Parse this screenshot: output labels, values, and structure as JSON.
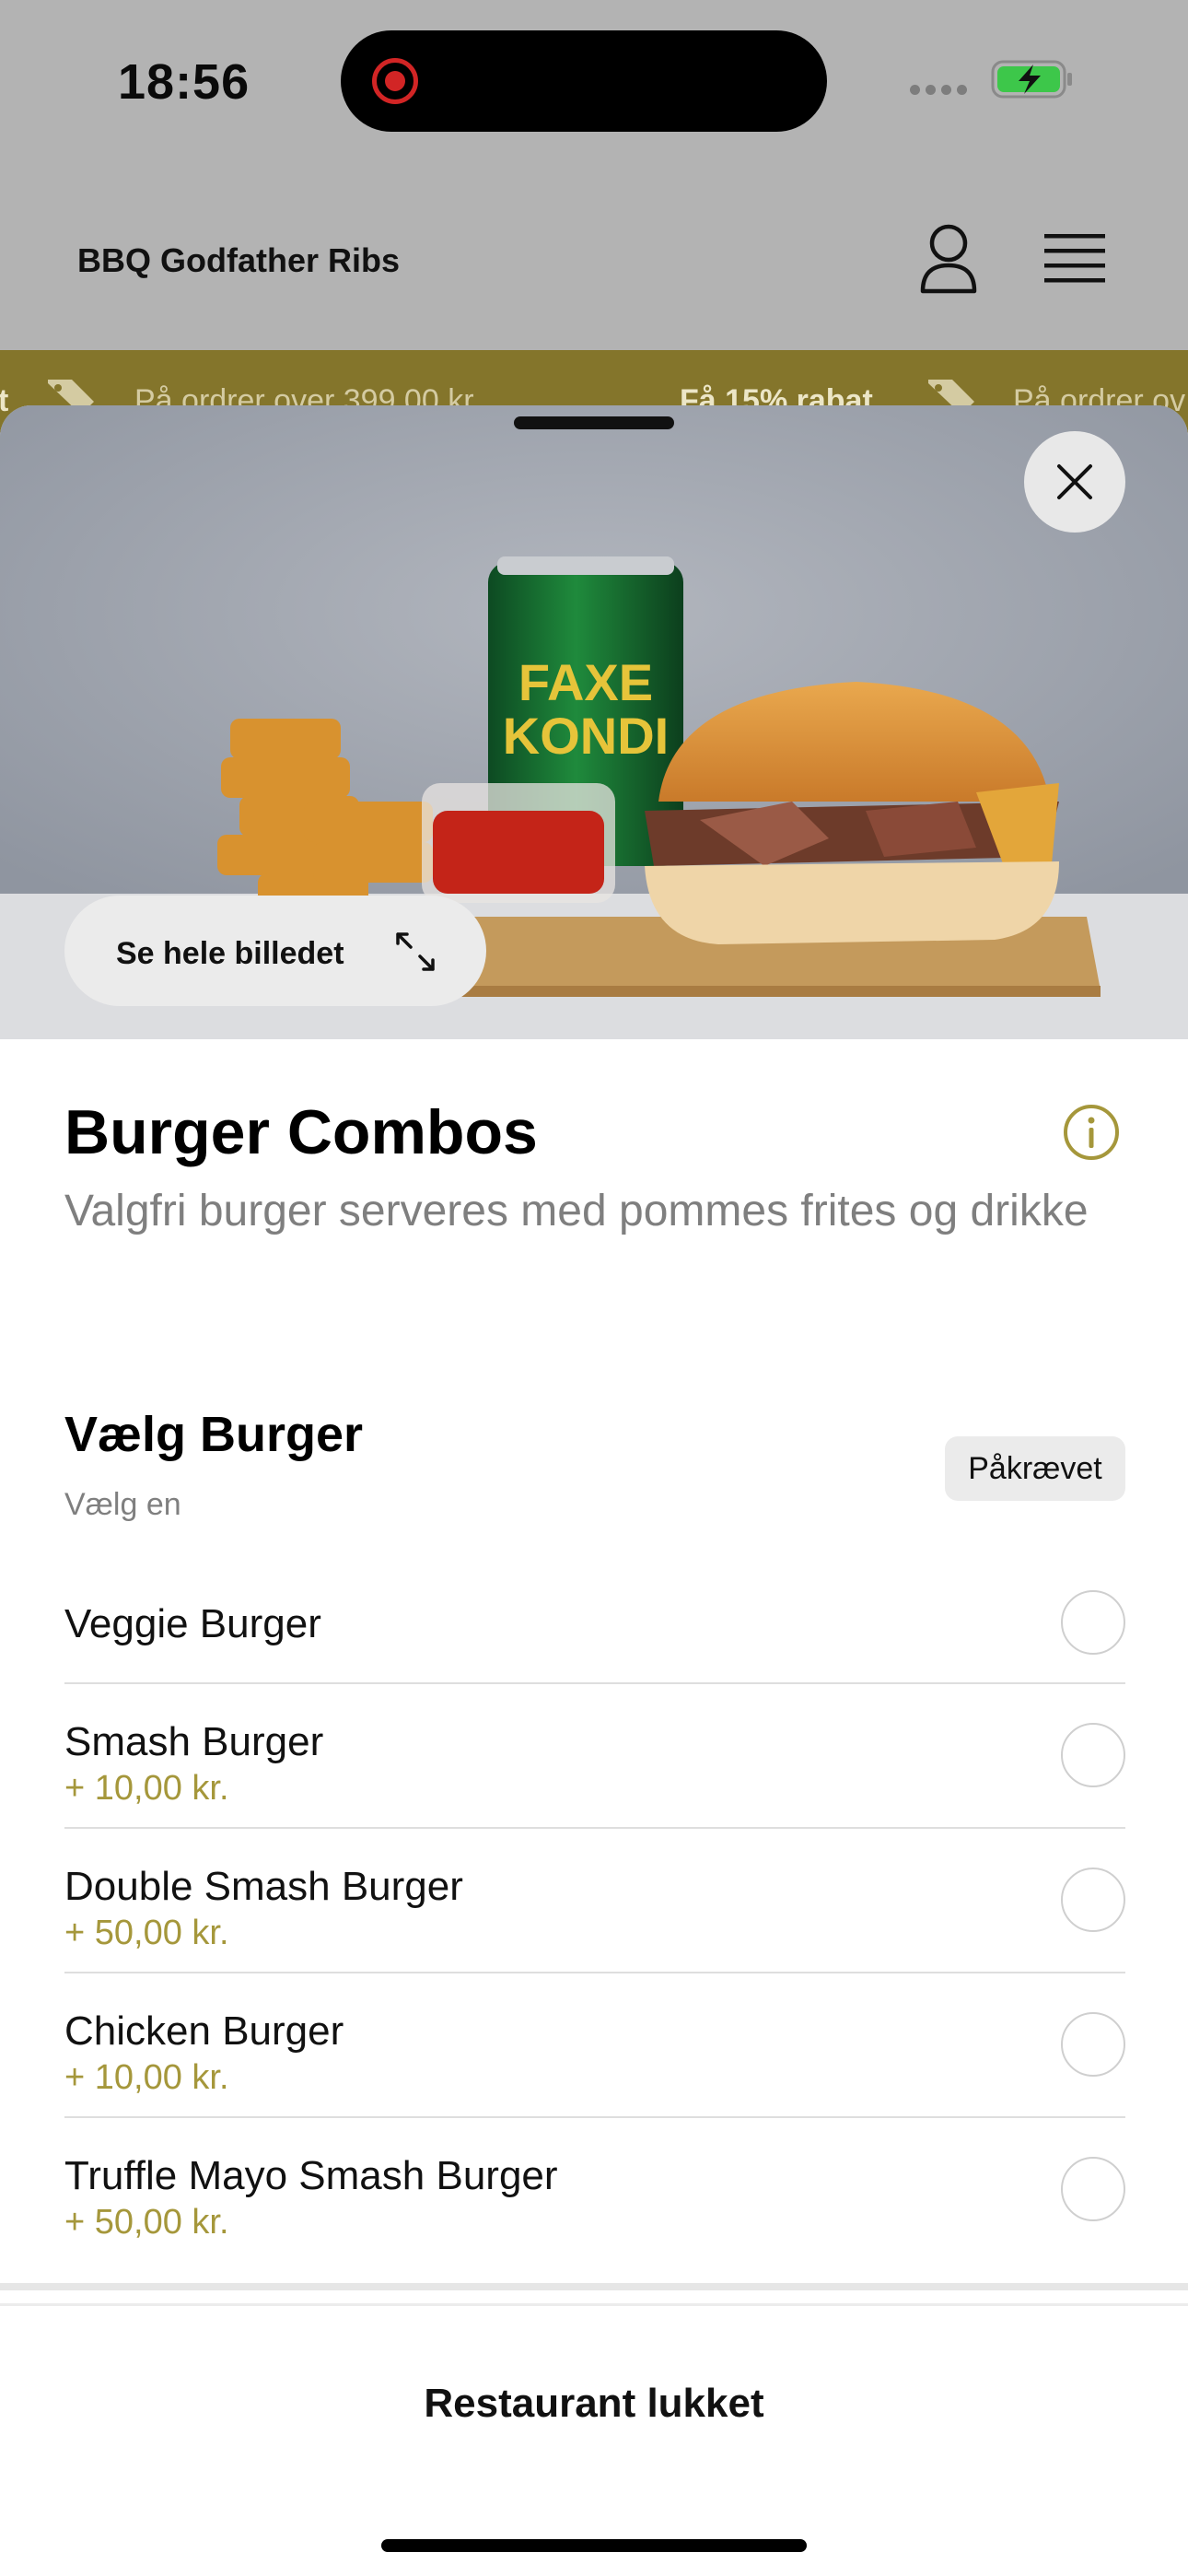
{
  "status_bar": {
    "time": "18:56"
  },
  "header": {
    "brand": "BBQ Godfather Ribs",
    "profile_icon": "person-icon",
    "menu_icon": "hamburger-menu-icon"
  },
  "promo_bar": {
    "items": [
      {
        "lead": "t",
        "text": ""
      },
      {
        "lead": "",
        "text": "På ordrer over 399,00 kr."
      },
      {
        "lead": "Få 15% rabat",
        "text": "På ordrer ov"
      }
    ],
    "color": "#84752b"
  },
  "hero": {
    "see_image_label": "Se hele billedet",
    "can_text_1": "FAXE",
    "can_text_2": "KONDI"
  },
  "product": {
    "title": "Burger Combos",
    "description": "Valgfri burger serveres med pommes frites og drikke"
  },
  "option_group": {
    "title": "Vælg Burger",
    "subtitle": "Vælg en",
    "badge": "Påkrævet",
    "options": [
      {
        "name": "Veggie Burger",
        "price": ""
      },
      {
        "name": "Smash Burger",
        "price": "+ 10,00 kr."
      },
      {
        "name": "Double Smash Burger",
        "price": "+ 50,00 kr."
      },
      {
        "name": "Chicken Burger",
        "price": "+ 10,00 kr."
      },
      {
        "name": "Truffle Mayo Smash Burger",
        "price": "+ 50,00 kr."
      }
    ]
  },
  "footer": {
    "label": "Restaurant lukket"
  },
  "colors": {
    "accent": "#a5973b",
    "promo": "#84752b"
  }
}
